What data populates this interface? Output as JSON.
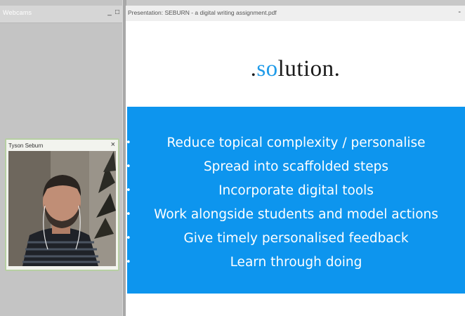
{
  "webcams": {
    "title": "Webcams",
    "minimize_glyph": "_",
    "maximize_glyph": "□"
  },
  "video_pod": {
    "name": "Tyson Seburn",
    "close_glyph": "×"
  },
  "presentation": {
    "title": "Presentation: SEBURN - a digital writing assignment.pdf",
    "minimize_glyph": "-"
  },
  "slide": {
    "heading_prefix": ".",
    "heading_accent": "so",
    "heading_rest": "lution.",
    "bullet_glyph": "•",
    "bullets": [
      "Reduce topical complexity / personalise",
      "Spread into scaffolded steps",
      "Incorporate digital tools",
      "Work alongside students and model actions",
      "Give timely personalised feedback",
      "Learn through doing"
    ]
  },
  "colors": {
    "slide_band": "#0d95ee",
    "heading_accent": "#1f9be9",
    "pod_border": "#b7cfa3"
  }
}
